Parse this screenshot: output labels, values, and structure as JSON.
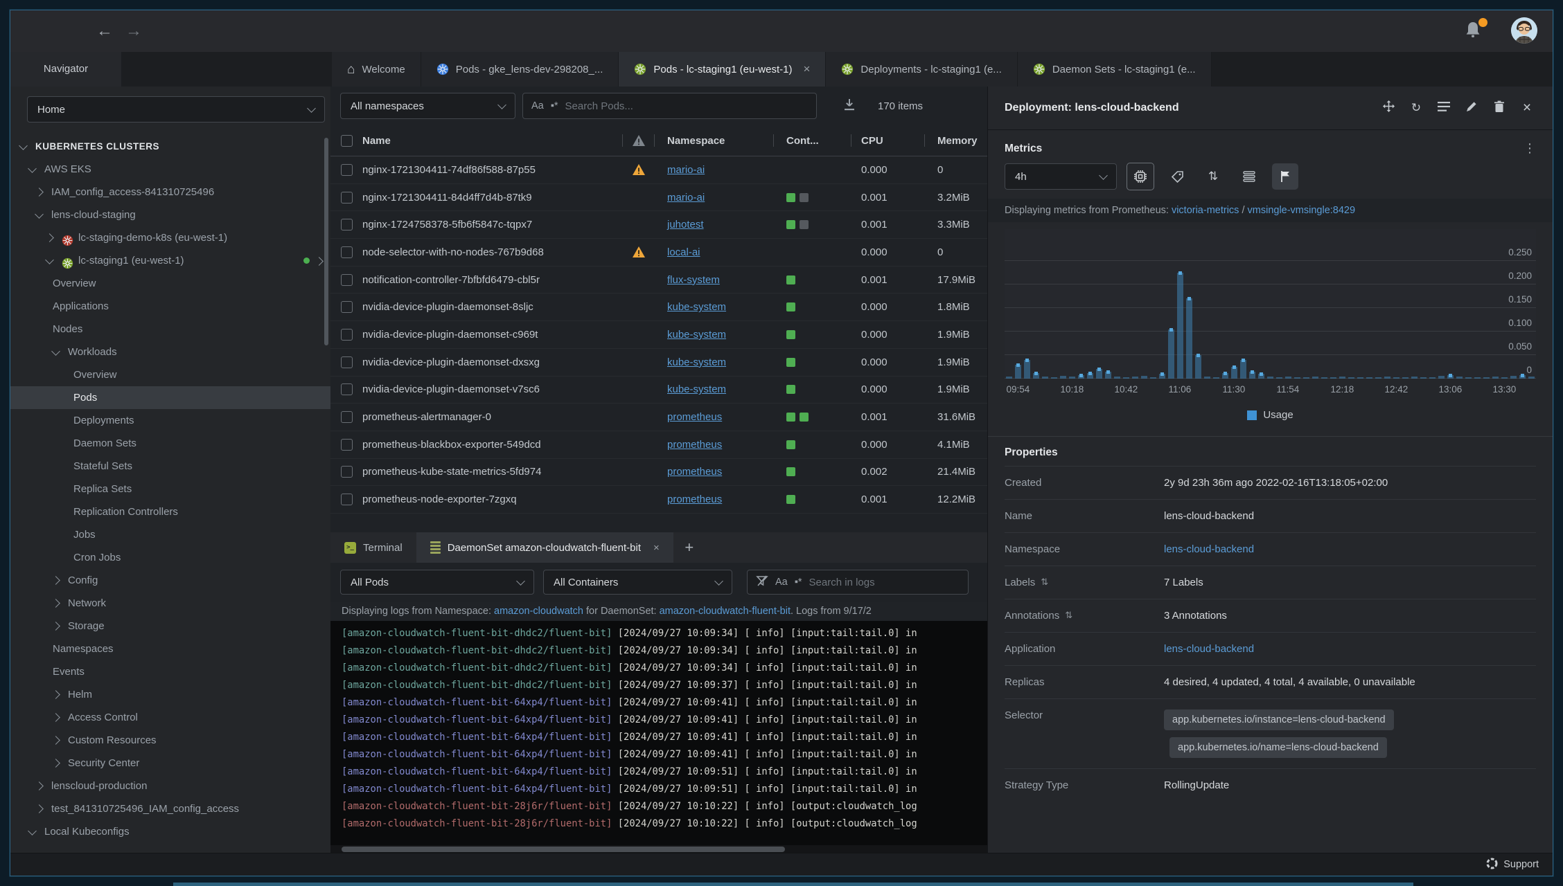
{
  "colors": {
    "link": "#5b9cd6",
    "warning": "#eea63a",
    "container_running": "#4fae52",
    "container_other": "#55595e",
    "chart_bar": "#3e81b3",
    "chart_marker": "#57a9df",
    "notification_badge": "#f59b23"
  },
  "toolbar": {
    "back_icon": "←",
    "forward_icon": "→",
    "bell_icon": "bell-icon",
    "avatar": "user-avatar"
  },
  "tabs": {
    "navigator_label": "Navigator",
    "items": [
      {
        "label": "Welcome",
        "icon": "home-icon",
        "active": false,
        "closable": false
      },
      {
        "label": "Pods - gke_lens-dev-298208_...",
        "icon": "kubernetes-icon-blue",
        "active": false,
        "closable": false
      },
      {
        "label": "Pods - lc-staging1 (eu-west-1)",
        "icon": "kubernetes-icon-green",
        "active": true,
        "closable": true
      },
      {
        "label": "Deployments - lc-staging1 (e...",
        "icon": "kubernetes-icon-green",
        "active": false,
        "closable": false
      },
      {
        "label": "Daemon Sets - lc-staging1 (e...",
        "icon": "kubernetes-icon-green",
        "active": false,
        "closable": false
      }
    ]
  },
  "sidebar": {
    "scope_select": "Home",
    "tree": [
      {
        "label": "KUBERNETES CLUSTERS",
        "level": 0,
        "chevron": "down",
        "header": true
      },
      {
        "label": "AWS EKS",
        "level": 1,
        "chevron": "down"
      },
      {
        "label": "IAM_config_access-841310725496",
        "level": 2,
        "chevron": "right"
      },
      {
        "label": "lens-cloud-staging",
        "level": 2,
        "chevron": "down"
      },
      {
        "label": "lc-staging-demo-k8s (eu-west-1)",
        "level": 3,
        "chevron": "right",
        "icon": "cluster-red"
      },
      {
        "label": "lc-staging1 (eu-west-1)",
        "level": 3,
        "chevron": "down",
        "icon": "cluster-green",
        "status_dot": true,
        "trail_chevron": true
      },
      {
        "label": "Overview",
        "level": 4
      },
      {
        "label": "Applications",
        "level": 4
      },
      {
        "label": "Nodes",
        "level": 4
      },
      {
        "label": "Workloads",
        "level": 4,
        "chevron": "down"
      },
      {
        "label": "Overview",
        "level": 5
      },
      {
        "label": "Pods",
        "level": 5,
        "selected": true
      },
      {
        "label": "Deployments",
        "level": 5
      },
      {
        "label": "Daemon Sets",
        "level": 5
      },
      {
        "label": "Stateful Sets",
        "level": 5
      },
      {
        "label": "Replica Sets",
        "level": 5
      },
      {
        "label": "Replication Controllers",
        "level": 5
      },
      {
        "label": "Jobs",
        "level": 5
      },
      {
        "label": "Cron Jobs",
        "level": 5
      },
      {
        "label": "Config",
        "level": 4,
        "chevron": "right"
      },
      {
        "label": "Network",
        "level": 4,
        "chevron": "right"
      },
      {
        "label": "Storage",
        "level": 4,
        "chevron": "right"
      },
      {
        "label": "Namespaces",
        "level": 4
      },
      {
        "label": "Events",
        "level": 4
      },
      {
        "label": "Helm",
        "level": 4,
        "chevron": "right"
      },
      {
        "label": "Access Control",
        "level": 4,
        "chevron": "right"
      },
      {
        "label": "Custom Resources",
        "level": 4,
        "chevron": "right"
      },
      {
        "label": "Security Center",
        "level": 4,
        "chevron": "right"
      },
      {
        "label": "lenscloud-production",
        "level": 2,
        "chevron": "right"
      },
      {
        "label": "test_841310725496_IAM_config_access",
        "level": 2,
        "chevron": "right"
      },
      {
        "label": "Local Kubeconfigs",
        "level": 1,
        "chevron": "down"
      }
    ]
  },
  "pods": {
    "namespace_filter": "All namespaces",
    "search_placeholder": "Search Pods...",
    "match_case_glyph": "Aa",
    "regex_glyph": "▪*",
    "items_count": "170 items",
    "columns": {
      "name": "Name",
      "namespace": "Namespace",
      "containers": "Cont...",
      "cpu": "CPU",
      "memory": "Memory"
    },
    "rows": [
      {
        "name": "nginx-1721304411-74df86f588-87p55",
        "warning": true,
        "namespace": "mario-ai",
        "containers": [],
        "cpu": "0.000",
        "memory": "0"
      },
      {
        "name": "nginx-1721304411-84d4ff7d4b-87tk9",
        "warning": false,
        "namespace": "mario-ai",
        "containers": [
          "running",
          "other"
        ],
        "cpu": "0.001",
        "memory": "3.2MiB"
      },
      {
        "name": "nginx-1724758378-5fb6f5847c-tqpx7",
        "warning": false,
        "namespace": "juhotest",
        "containers": [
          "running",
          "other"
        ],
        "cpu": "0.001",
        "memory": "3.3MiB"
      },
      {
        "name": "node-selector-with-no-nodes-767b9d68",
        "warning": true,
        "namespace": "local-ai",
        "containers": [],
        "cpu": "0.000",
        "memory": "0"
      },
      {
        "name": "notification-controller-7bfbfd6479-cbl5r",
        "warning": false,
        "namespace": "flux-system",
        "containers": [
          "running"
        ],
        "cpu": "0.001",
        "memory": "17.9MiB"
      },
      {
        "name": "nvidia-device-plugin-daemonset-8sljc",
        "warning": false,
        "namespace": "kube-system",
        "containers": [
          "running"
        ],
        "cpu": "0.000",
        "memory": "1.8MiB"
      },
      {
        "name": "nvidia-device-plugin-daemonset-c969t",
        "warning": false,
        "namespace": "kube-system",
        "containers": [
          "running"
        ],
        "cpu": "0.000",
        "memory": "1.9MiB"
      },
      {
        "name": "nvidia-device-plugin-daemonset-dxsxg",
        "warning": false,
        "namespace": "kube-system",
        "containers": [
          "running"
        ],
        "cpu": "0.000",
        "memory": "1.9MiB"
      },
      {
        "name": "nvidia-device-plugin-daemonset-v7sc6",
        "warning": false,
        "namespace": "kube-system",
        "containers": [
          "running"
        ],
        "cpu": "0.000",
        "memory": "1.9MiB"
      },
      {
        "name": "prometheus-alertmanager-0",
        "warning": false,
        "namespace": "prometheus",
        "containers": [
          "running",
          "running"
        ],
        "cpu": "0.001",
        "memory": "31.6MiB"
      },
      {
        "name": "prometheus-blackbox-exporter-549dcd",
        "warning": false,
        "namespace": "prometheus",
        "containers": [
          "running"
        ],
        "cpu": "0.000",
        "memory": "4.1MiB"
      },
      {
        "name": "prometheus-kube-state-metrics-5fd974",
        "warning": false,
        "namespace": "prometheus",
        "containers": [
          "running"
        ],
        "cpu": "0.002",
        "memory": "21.4MiB"
      },
      {
        "name": "prometheus-node-exporter-7zgxq",
        "warning": false,
        "namespace": "prometheus",
        "containers": [
          "running"
        ],
        "cpu": "0.001",
        "memory": "12.2MiB"
      }
    ]
  },
  "dock": {
    "tabs": [
      {
        "label": "Terminal",
        "icon": "terminal-icon",
        "active": false,
        "closable": false
      },
      {
        "label": "DaemonSet amazon-cloudwatch-fluent-bit",
        "icon": "logs-icon",
        "active": true,
        "closable": true
      }
    ],
    "new_tab_glyph": "+",
    "pod_filter": "All Pods",
    "container_filter": "All Containers",
    "search_placeholder": "Search in logs",
    "match_case_glyph": "Aa",
    "regex_glyph": "▪*",
    "info": {
      "prefix": "Displaying logs from Namespace: ",
      "namespace_link": "amazon-cloudwatch",
      "middle": " for DaemonSet: ",
      "daemonset_link": "amazon-cloudwatch-fluent-bit",
      "suffix": ". Logs from 9/17/2"
    },
    "lines": [
      {
        "pod": "[amazon-cloudwatch-fluent-bit-dhdc2/fluent-bit]",
        "color": "teal",
        "time": "[2024/09/27 10:09:34]",
        "msg": "[ info] [input:tail:tail.0] in"
      },
      {
        "pod": "[amazon-cloudwatch-fluent-bit-dhdc2/fluent-bit]",
        "color": "teal",
        "time": "[2024/09/27 10:09:34]",
        "msg": "[ info] [input:tail:tail.0] in"
      },
      {
        "pod": "[amazon-cloudwatch-fluent-bit-dhdc2/fluent-bit]",
        "color": "teal",
        "time": "[2024/09/27 10:09:34]",
        "msg": "[ info] [input:tail:tail.0] in"
      },
      {
        "pod": "[amazon-cloudwatch-fluent-bit-dhdc2/fluent-bit]",
        "color": "teal",
        "time": "[2024/09/27 10:09:37]",
        "msg": "[ info] [input:tail:tail.0] in"
      },
      {
        "pod": "[amazon-cloudwatch-fluent-bit-64xp4/fluent-bit]",
        "color": "purple",
        "time": "[2024/09/27 10:09:41]",
        "msg": "[ info] [input:tail:tail.0] in"
      },
      {
        "pod": "[amazon-cloudwatch-fluent-bit-64xp4/fluent-bit]",
        "color": "purple",
        "time": "[2024/09/27 10:09:41]",
        "msg": "[ info] [input:tail:tail.0] in"
      },
      {
        "pod": "[amazon-cloudwatch-fluent-bit-64xp4/fluent-bit]",
        "color": "purple",
        "time": "[2024/09/27 10:09:41]",
        "msg": "[ info] [input:tail:tail.0] in"
      },
      {
        "pod": "[amazon-cloudwatch-fluent-bit-64xp4/fluent-bit]",
        "color": "purple",
        "time": "[2024/09/27 10:09:41]",
        "msg": "[ info] [input:tail:tail.0] in"
      },
      {
        "pod": "[amazon-cloudwatch-fluent-bit-64xp4/fluent-bit]",
        "color": "purple",
        "time": "[2024/09/27 10:09:51]",
        "msg": "[ info] [input:tail:tail.0] in"
      },
      {
        "pod": "[amazon-cloudwatch-fluent-bit-64xp4/fluent-bit]",
        "color": "purple",
        "time": "[2024/09/27 10:09:51]",
        "msg": "[ info] [input:tail:tail.0] in"
      },
      {
        "pod": "[amazon-cloudwatch-fluent-bit-28j6r/fluent-bit]",
        "color": "red",
        "time": "[2024/09/27 10:10:22]",
        "msg": "[ info] [output:cloudwatch_log"
      },
      {
        "pod": "[amazon-cloudwatch-fluent-bit-28j6r/fluent-bit]",
        "color": "red",
        "time": "[2024/09/27 10:10:22]",
        "msg": "[ info] [output:cloudwatch_log"
      }
    ]
  },
  "details": {
    "title": "Deployment: lens-cloud-backend",
    "header_icons": [
      "move-icon",
      "refresh-icon",
      "menu-icon",
      "edit-icon",
      "trash-icon",
      "close-icon"
    ],
    "metrics": {
      "title": "Metrics",
      "range": "4h",
      "toolbar_icons": [
        "cpu-chip-icon",
        "tag-icon",
        "sort-arrows-icon",
        "stacked-list-icon",
        "flag-icon"
      ],
      "source_prefix": "Displaying metrics from Prometheus: ",
      "source_link1": "victoria-metrics",
      "source_sep": " / ",
      "source_link2": "vmsingle-vmsingle:8429",
      "legend": "Usage"
    },
    "properties": {
      "title": "Properties",
      "created_label": "Created",
      "created": "2y 9d 23h 36m ago 2022-02-16T13:18:05+02:00",
      "name_label": "Name",
      "name": "lens-cloud-backend",
      "namespace_label": "Namespace",
      "namespace": "lens-cloud-backend",
      "labels_label": "Labels",
      "labels": "7 Labels",
      "annotations_label": "Annotations",
      "annotations": "3 Annotations",
      "application_label": "Application",
      "application": "lens-cloud-backend",
      "replicas_label": "Replicas",
      "replicas": "4 desired, 4 updated, 4 total, 4 available, 0 unavailable",
      "selector_label": "Selector",
      "selector": [
        "app.kubernetes.io/instance=lens-cloud-backend",
        "app.kubernetes.io/name=lens-cloud-backend"
      ],
      "strategy_label": "Strategy Type",
      "strategy": "RollingUpdate"
    }
  },
  "chart_data": {
    "type": "bar",
    "series": [
      {
        "name": "Usage",
        "values": [
          0.004,
          0.03,
          0.04,
          0.012,
          0.004,
          0.003,
          0.006,
          0.004,
          0.008,
          0.012,
          0.02,
          0.014,
          0.004,
          0.003,
          0.005,
          0.006,
          0.003,
          0.01,
          0.105,
          0.225,
          0.17,
          0.05,
          0.004,
          0.003,
          0.012,
          0.025,
          0.04,
          0.014,
          0.01,
          0.004,
          0.003,
          0.004,
          0.003,
          0.002,
          0.004,
          0.003,
          0.002,
          0.005,
          0.003,
          0.002,
          0.003,
          0.002,
          0.004,
          0.003,
          0.002,
          0.005,
          0.003,
          0.002,
          0.006,
          0.008,
          0.004,
          0.002,
          0.003,
          0.002,
          0.004,
          0.003,
          0.006,
          0.008,
          0.004
        ]
      }
    ],
    "x_ticks": [
      {
        "label": "09:54",
        "index": 1
      },
      {
        "label": "10:18",
        "index": 7
      },
      {
        "label": "10:42",
        "index": 13
      },
      {
        "label": "11:06",
        "index": 19
      },
      {
        "label": "11:30",
        "index": 25
      },
      {
        "label": "11:54",
        "index": 31
      },
      {
        "label": "12:18",
        "index": 37
      },
      {
        "label": "12:42",
        "index": 43
      },
      {
        "label": "13:06",
        "index": 49
      },
      {
        "label": "13:30",
        "index": 55
      }
    ],
    "y_ticks": [
      "0",
      "0.050",
      "0.100",
      "0.150",
      "0.200",
      "0.250"
    ],
    "ylim": [
      0,
      0.25
    ],
    "grid": true,
    "legend_position": "bottom"
  },
  "footer": {
    "support": "Support"
  }
}
